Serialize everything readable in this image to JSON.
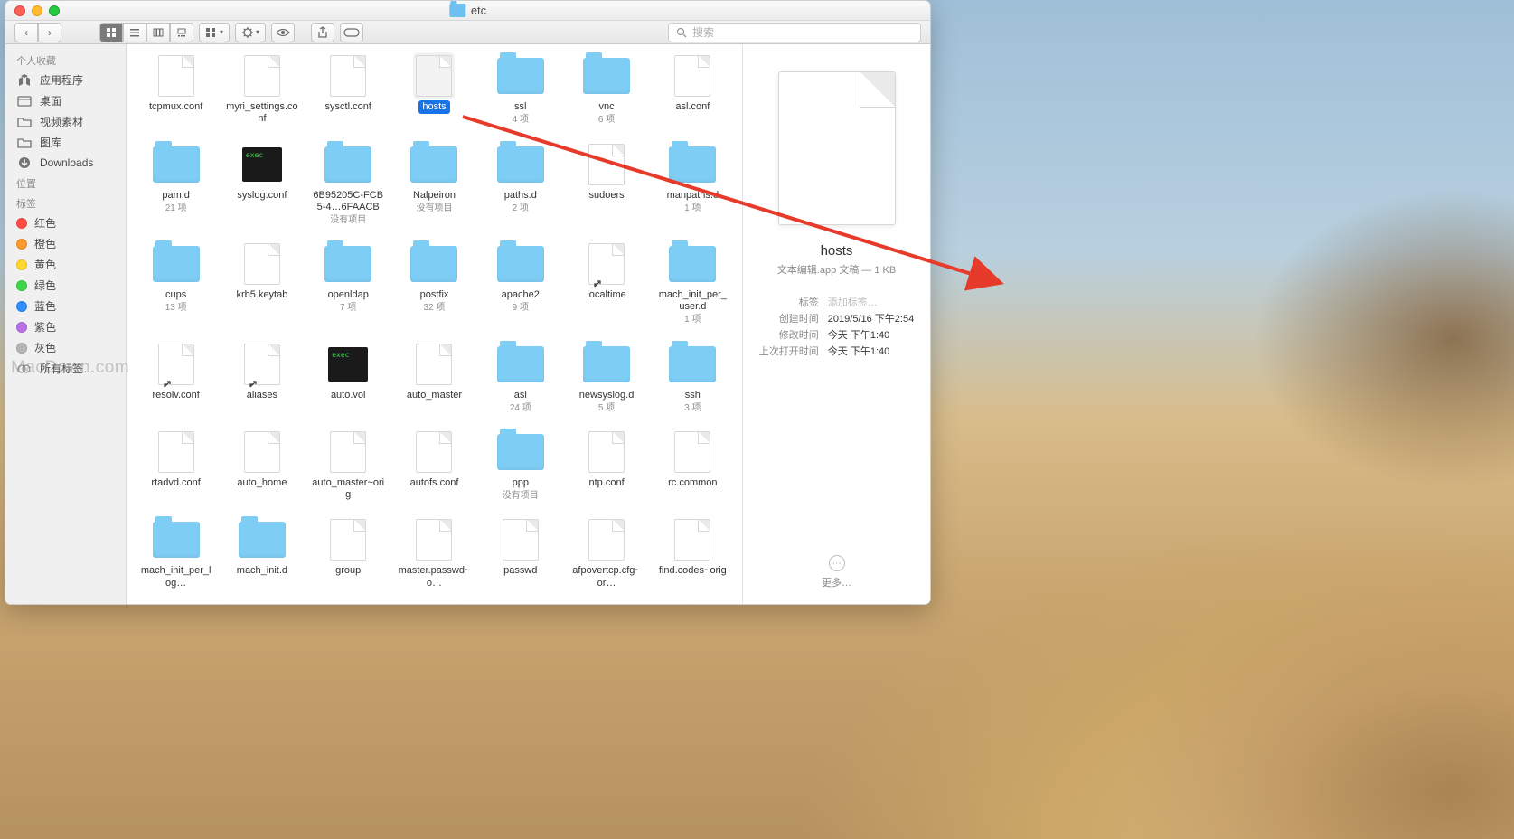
{
  "window": {
    "title": "etc",
    "search_placeholder": "搜索"
  },
  "sidebar": {
    "sections": [
      {
        "label": "个人收藏"
      },
      {
        "label": "位置"
      },
      {
        "label": "标签"
      }
    ],
    "favorites": [
      {
        "label": "应用程序",
        "icon": "app"
      },
      {
        "label": "桌面",
        "icon": "window"
      },
      {
        "label": "视频素材",
        "icon": "folder"
      },
      {
        "label": "图库",
        "icon": "folder"
      },
      {
        "label": "Downloads",
        "icon": "download"
      }
    ],
    "tags": [
      {
        "label": "红色",
        "color": "#ff4c42"
      },
      {
        "label": "橙色",
        "color": "#ff9a2e"
      },
      {
        "label": "黄色",
        "color": "#ffd52e"
      },
      {
        "label": "绿色",
        "color": "#3dd44a"
      },
      {
        "label": "蓝色",
        "color": "#2e8dff"
      },
      {
        "label": "紫色",
        "color": "#b86fe6"
      },
      {
        "label": "灰色",
        "color": "#b5b5b5"
      },
      {
        "label": "所有标签…",
        "color": null
      }
    ]
  },
  "items": [
    {
      "name": "tcpmux.conf",
      "type": "doc",
      "sub": ""
    },
    {
      "name": "myri_settings.conf",
      "type": "doc",
      "sub": ""
    },
    {
      "name": "sysctl.conf",
      "type": "doc",
      "sub": ""
    },
    {
      "name": "hosts",
      "type": "doc",
      "sub": "",
      "selected": true
    },
    {
      "name": "ssl",
      "type": "folder",
      "sub": "4 项"
    },
    {
      "name": "vnc",
      "type": "folder",
      "sub": "6 项"
    },
    {
      "name": "asl.conf",
      "type": "doc",
      "sub": ""
    },
    {
      "name": "pam.d",
      "type": "folder",
      "sub": "21 项"
    },
    {
      "name": "syslog.conf",
      "type": "exec",
      "sub": ""
    },
    {
      "name": "6B95205C-FCB5-4…6FAACB",
      "type": "folder",
      "sub": "没有项目"
    },
    {
      "name": "Nalpeiron",
      "type": "folder",
      "sub": "没有项目"
    },
    {
      "name": "paths.d",
      "type": "folder",
      "sub": "2 项"
    },
    {
      "name": "sudoers",
      "type": "doc",
      "sub": ""
    },
    {
      "name": "manpaths.d",
      "type": "folder",
      "sub": "1 项"
    },
    {
      "name": "cups",
      "type": "folder",
      "sub": "13 项"
    },
    {
      "name": "krb5.keytab",
      "type": "doc",
      "sub": ""
    },
    {
      "name": "openldap",
      "type": "folder",
      "sub": "7 项"
    },
    {
      "name": "postfix",
      "type": "folder",
      "sub": "32 项"
    },
    {
      "name": "apache2",
      "type": "folder",
      "sub": "9 项"
    },
    {
      "name": "localtime",
      "type": "doc",
      "sub": "",
      "alias": true
    },
    {
      "name": "mach_init_per_user.d",
      "type": "folder",
      "sub": "1 项"
    },
    {
      "name": "resolv.conf",
      "type": "doc",
      "sub": "",
      "alias": true
    },
    {
      "name": "aliases",
      "type": "doc",
      "sub": "",
      "alias": true
    },
    {
      "name": "auto.vol",
      "type": "exec",
      "sub": ""
    },
    {
      "name": "auto_master",
      "type": "doc",
      "sub": ""
    },
    {
      "name": "asl",
      "type": "folder",
      "sub": "24 项"
    },
    {
      "name": "newsyslog.d",
      "type": "folder",
      "sub": "5 项"
    },
    {
      "name": "ssh",
      "type": "folder",
      "sub": "3 项"
    },
    {
      "name": "rtadvd.conf",
      "type": "doc",
      "sub": ""
    },
    {
      "name": "auto_home",
      "type": "doc",
      "sub": ""
    },
    {
      "name": "auto_master~orig",
      "type": "doc",
      "sub": ""
    },
    {
      "name": "autofs.conf",
      "type": "doc",
      "sub": ""
    },
    {
      "name": "ppp",
      "type": "folder",
      "sub": "没有项目"
    },
    {
      "name": "ntp.conf",
      "type": "doc",
      "sub": ""
    },
    {
      "name": "rc.common",
      "type": "doc",
      "sub": ""
    },
    {
      "name": "mach_init_per_log…",
      "type": "folder",
      "sub": ""
    },
    {
      "name": "mach_init.d",
      "type": "folder",
      "sub": ""
    },
    {
      "name": "group",
      "type": "doc",
      "sub": ""
    },
    {
      "name": "master.passwd~o…",
      "type": "doc",
      "sub": ""
    },
    {
      "name": "passwd",
      "type": "doc",
      "sub": ""
    },
    {
      "name": "afpovertcp.cfg~or…",
      "type": "doc",
      "sub": ""
    },
    {
      "name": "find.codes~orig",
      "type": "doc",
      "sub": ""
    }
  ],
  "preview": {
    "name": "hosts",
    "kind": "文本编辑.app 文稿 — 1 KB",
    "meta": [
      {
        "k": "标签",
        "v": "添加标签…",
        "placeholder": true
      },
      {
        "k": "创建时间",
        "v": "2019/5/16 下午2:54"
      },
      {
        "k": "修改时间",
        "v": "今天 下午1:40"
      },
      {
        "k": "上次打开时间",
        "v": "今天 下午1:40"
      }
    ],
    "more": "更多…"
  },
  "watermark": "MacDown.com"
}
